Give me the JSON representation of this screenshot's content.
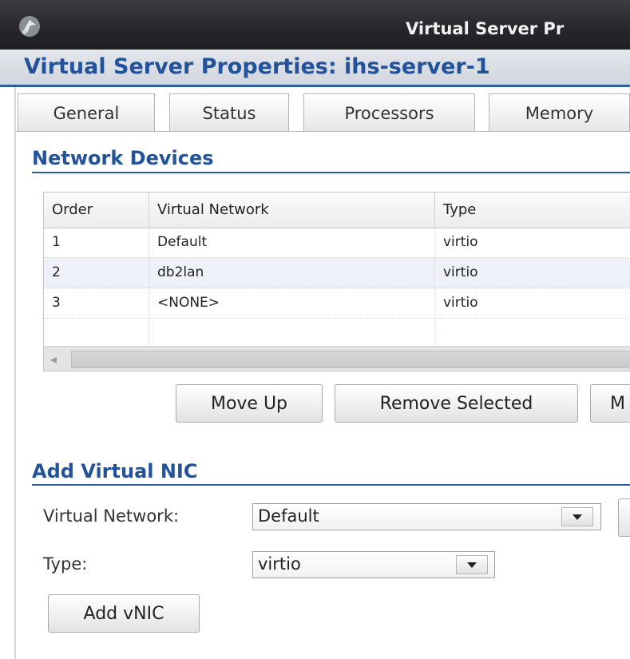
{
  "window": {
    "title": "Virtual Server Pr"
  },
  "header": {
    "title": "Virtual Server Properties: ihs-server-1"
  },
  "tabs": [
    {
      "label": "General"
    },
    {
      "label": "Status"
    },
    {
      "label": "Processors"
    },
    {
      "label": "Memory"
    }
  ],
  "network_devices": {
    "title": "Network Devices",
    "columns": [
      "Order",
      "Virtual Network",
      "Type"
    ],
    "rows": [
      {
        "order": "1",
        "network": "Default",
        "type": "virtio"
      },
      {
        "order": "2",
        "network": "db2lan",
        "type": "virtio"
      },
      {
        "order": "3",
        "network": "<NONE>",
        "type": "virtio"
      }
    ],
    "buttons": {
      "move_up": "Move Up",
      "remove_selected": "Remove Selected",
      "partial": "M"
    }
  },
  "add_vnic": {
    "title": "Add Virtual NIC",
    "virtual_network_label": "Virtual Network:",
    "virtual_network_value": "Default",
    "type_label": "Type:",
    "type_value": "virtio",
    "add_button": "Add vNIC"
  },
  "icons": {
    "app": "app-logo-icon",
    "dropdown": "chevron-down-icon",
    "scroll_left": "scroll-left-arrow-icon"
  },
  "colors": {
    "accent": "#22539a",
    "titlebar": "#26282c",
    "row_alt": "#eef2f8"
  }
}
